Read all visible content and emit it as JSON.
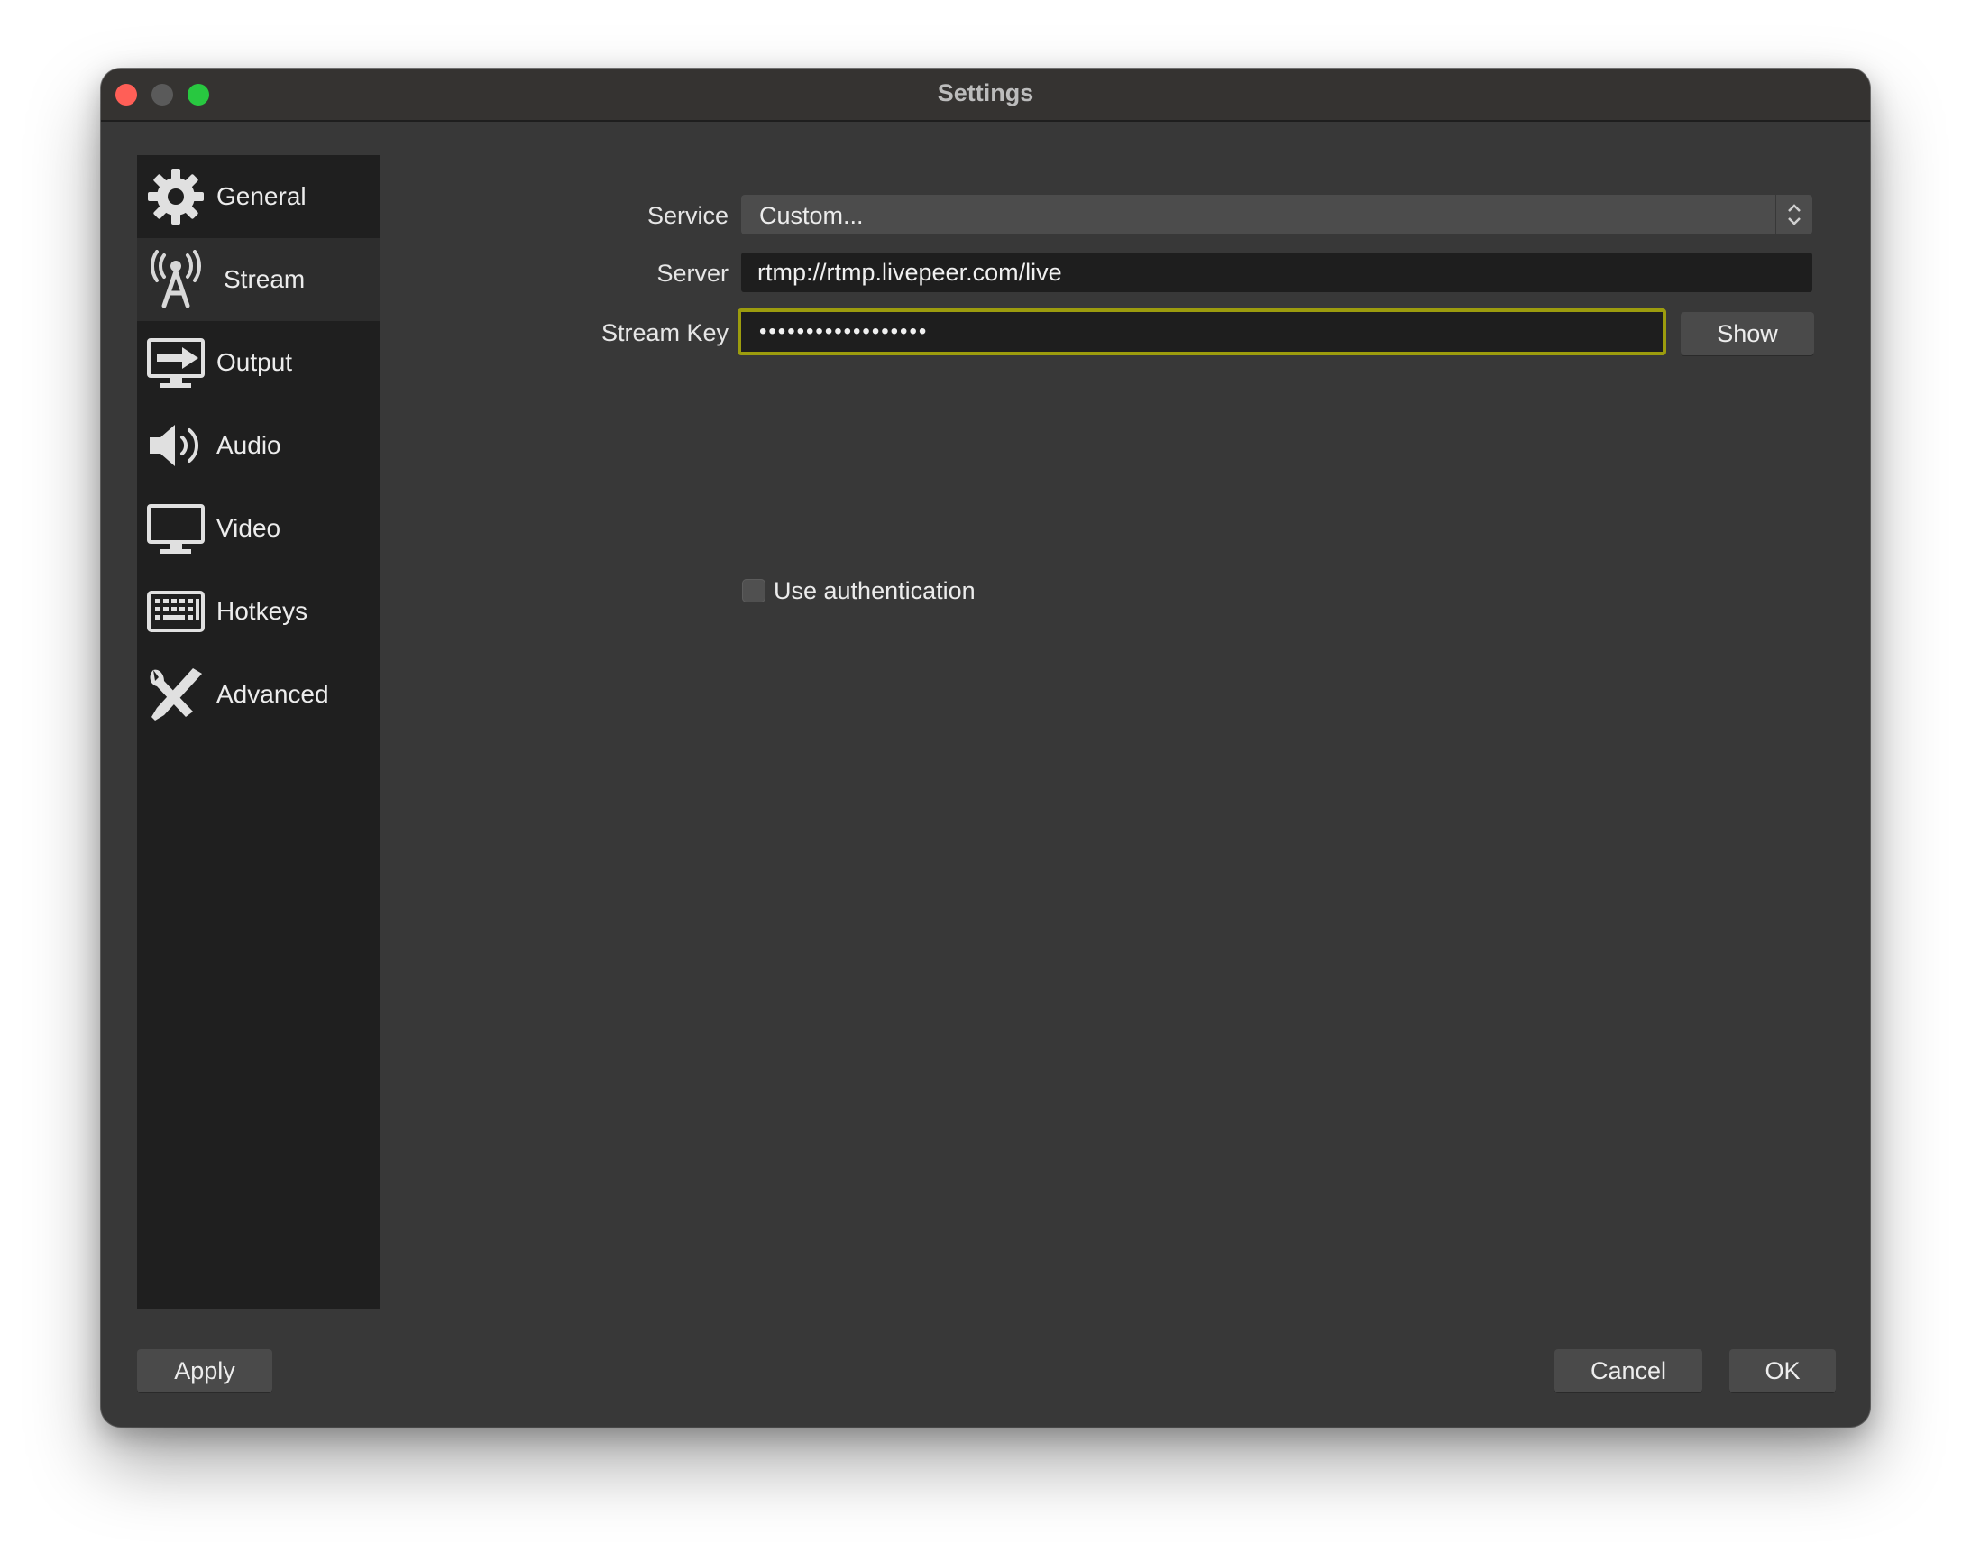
{
  "window": {
    "title": "Settings"
  },
  "sidebar": {
    "items": [
      {
        "label": "General",
        "icon": "gear-icon"
      },
      {
        "label": "Stream",
        "icon": "broadcast-antenna-icon",
        "active": true
      },
      {
        "label": "Output",
        "icon": "monitor-arrow-icon"
      },
      {
        "label": "Audio",
        "icon": "speaker-icon"
      },
      {
        "label": "Video",
        "icon": "monitor-icon"
      },
      {
        "label": "Hotkeys",
        "icon": "keyboard-icon"
      },
      {
        "label": "Advanced",
        "icon": "tools-icon"
      }
    ]
  },
  "stream": {
    "service_label": "Service",
    "service_value": "Custom...",
    "server_label": "Server",
    "server_value": "rtmp://rtmp.livepeer.com/live",
    "key_label": "Stream Key",
    "key_value": "••••••••••••••••••",
    "show_label": "Show",
    "auth_label": "Use authentication",
    "auth_checked": false
  },
  "footer": {
    "apply_label": "Apply",
    "cancel_label": "Cancel",
    "ok_label": "OK"
  },
  "colors": {
    "window_bg": "#383838",
    "sidebar_bg": "#1f1f1f",
    "focus_ring": "#9c9c0e",
    "close": "#ff5f57",
    "zoom": "#28c840"
  }
}
